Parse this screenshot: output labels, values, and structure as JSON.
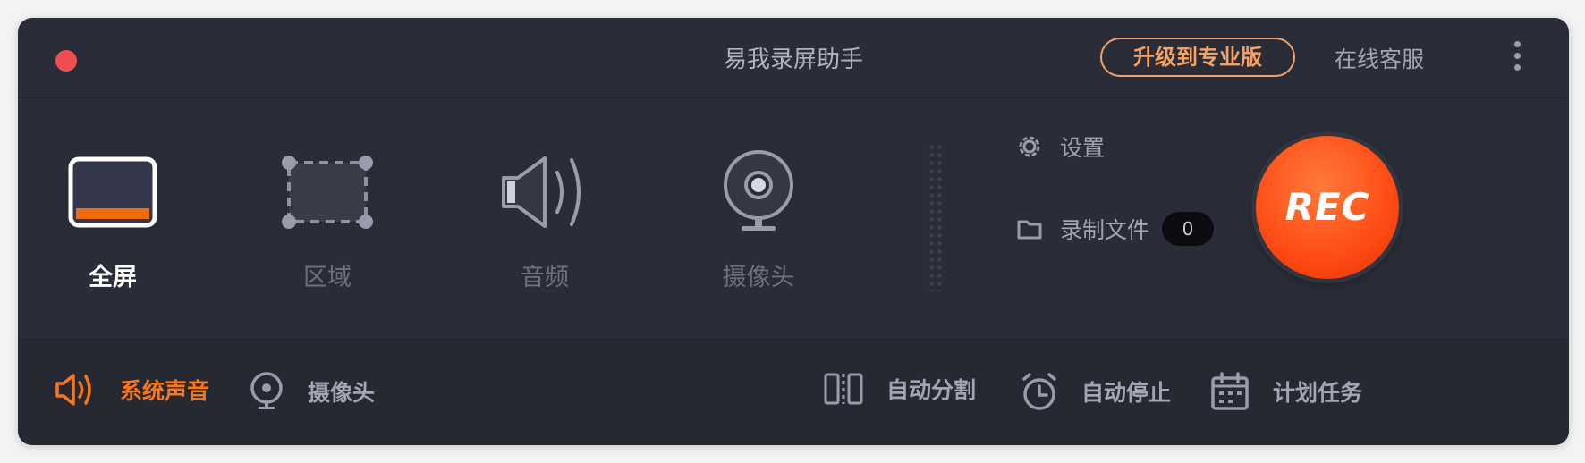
{
  "titlebar": {
    "title": "易我录屏助手",
    "upgrade_label": "升级到专业版",
    "support_label": "在线客服"
  },
  "modes": [
    {
      "label": "全屏",
      "icon": "monitor-icon",
      "active": true
    },
    {
      "label": "区域",
      "icon": "region-select-icon",
      "active": false
    },
    {
      "label": "音频",
      "icon": "speaker-icon",
      "active": false
    },
    {
      "label": "摄像头",
      "icon": "webcam-icon",
      "active": false
    }
  ],
  "side": {
    "settings_label": "设置",
    "files_label": "录制文件",
    "files_count": "0"
  },
  "rec_label": "REC",
  "bottom": {
    "system_sound": "系统声音",
    "camera": "摄像头",
    "auto_split": "自动分割",
    "auto_stop": "自动停止",
    "schedule": "计划任务"
  },
  "colors": {
    "accent": "#f7771f",
    "rec": "#ff4b14",
    "background": "#2a2c37"
  }
}
